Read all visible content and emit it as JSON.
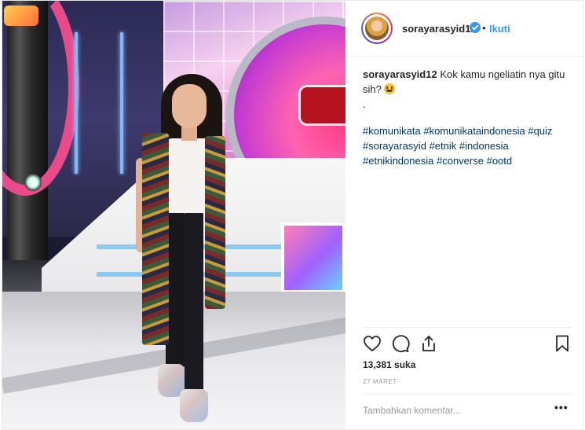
{
  "post": {
    "username": "sorayarasyid12",
    "separator": "•",
    "follow_label": "Ikuti",
    "caption": {
      "username": "sorayarasyid12",
      "text": "Kok kamu ngeliatin nya gitu sih?",
      "dot_line": ".",
      "hashtags": [
        "#komunikata",
        "#komunikataindonesia",
        "#quiz",
        "#sorayarasyid",
        "#etnik",
        "#indonesia",
        "#etnikindonesia",
        "#converse",
        "#ootd"
      ]
    },
    "likes": "13,381 suka",
    "date": "27 MARET",
    "comment_placeholder": "Tambahkan komentar...",
    "more_label": "•••"
  },
  "icons": {
    "like": "heart-icon",
    "comment": "comment-icon",
    "share": "share-icon",
    "save": "bookmark-icon",
    "verified": "verified-badge-icon"
  },
  "colors": {
    "link_blue": "#3897f0",
    "hashtag": "#003569",
    "text": "#262626",
    "muted": "#999999"
  }
}
